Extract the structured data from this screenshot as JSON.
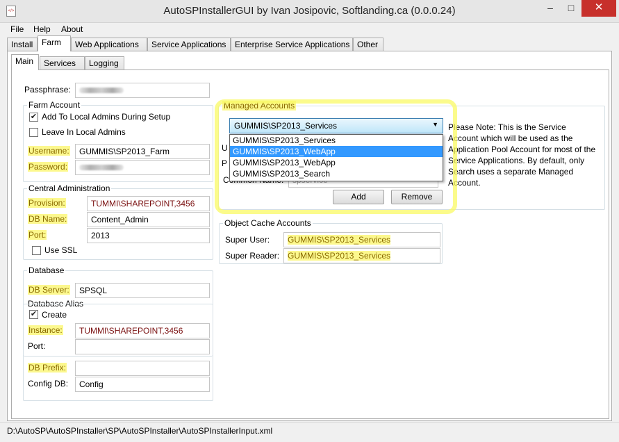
{
  "window": {
    "title": "AutoSPInstallerGUI by Ivan Josipovic, Softlanding.ca (0.0.0.24)",
    "minimize": "–",
    "maximize": "□",
    "close": "✕",
    "icon_text": "</>"
  },
  "menu": [
    "File",
    "Help",
    "About"
  ],
  "tabs": [
    "Install",
    "Farm",
    "Web Applications",
    "Service Applications",
    "Enterprise Service Applications",
    "Other"
  ],
  "subtabs": [
    "Main",
    "Services",
    "Logging"
  ],
  "main": {
    "passphrase_label": "Passphrase:",
    "farm_account": {
      "title": "Farm Account",
      "add_local_admins": "Add To Local Admins During Setup",
      "leave_local_admins": "Leave In Local Admins",
      "username_label": "Username:",
      "username_value": "GUMMIS\\SP2013_Farm",
      "password_label": "Password:"
    },
    "central_admin": {
      "title": "Central Administration",
      "provision_label": "Provision:",
      "provision_value": "TUMMI\\SHAREPOINT,3456",
      "dbname_label": "DB Name:",
      "dbname_value": "Content_Admin",
      "port_label": "Port:",
      "port_value": "2013",
      "ssl_label": "Use SSL"
    },
    "database": {
      "title": "Database",
      "server_label": "DB Server:",
      "server_value": "SPSQL",
      "alias_title": "Database Alias",
      "create_label": "Create",
      "instance_label": "Instance:",
      "instance_value": "TUMMI\\SHAREPOINT,3456",
      "port_label": "Port:",
      "port_value": "",
      "prefix_label": "DB Prefix:",
      "prefix_value": "",
      "config_label": "Config DB:",
      "config_value": "Config"
    },
    "managed_accounts": {
      "title": "Managed Accounts",
      "selected": "GUMMIS\\SP2013_Services",
      "options": [
        "GUMMIS\\SP2013_Services",
        "GUMMIS\\SP2013_WebApp",
        "GUMMIS\\SP2013_WebApp",
        "GUMMIS\\SP2013_Search"
      ],
      "hidden_label_u": "U",
      "hidden_label_p": "P",
      "common_name_label": "Common Name:",
      "common_name_value": "spservice",
      "note": "Please Note: This is the Service Account which will be used as the Application Pool Account for most of the Service Applications. By default, only Search uses a separate Managed Account.",
      "add_button": "Add",
      "remove_button": "Remove"
    },
    "object_cache": {
      "title": "Object Cache Accounts",
      "super_user_label": "Super User:",
      "super_user_value": "GUMMIS\\SP2013_Services",
      "super_reader_label": "Super Reader:",
      "super_reader_value": "GUMMIS\\SP2013_Services"
    }
  },
  "status": {
    "path": "D:\\AutoSP\\AutoSPInstaller\\SP\\AutoSPInstaller\\AutoSPInstallerInput.xml"
  }
}
